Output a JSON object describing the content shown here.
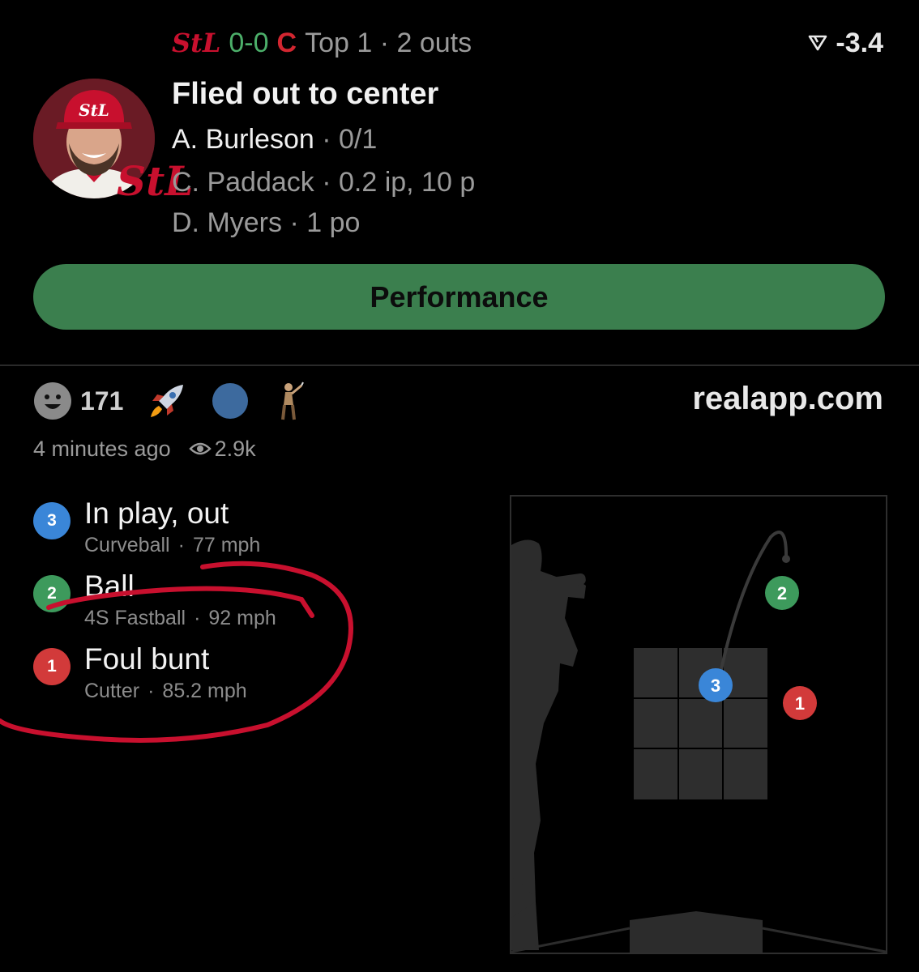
{
  "header": {
    "away_team_logo": "StL",
    "score": "0-0",
    "home_team_logo": "C",
    "inning_status": "Top 1 · 2 outs",
    "win_prob_change": "-3.4",
    "team_color_away": "#c8102e",
    "team_color_home": "#d22630"
  },
  "play": {
    "title": "Flied out to center",
    "batter_name": "A. Burleson",
    "batter_stats": "· 0/1",
    "pitcher_name": "C. Paddack",
    "pitcher_stats": "· 0.2 ip, 10 p",
    "fielder_name": "D. Myers",
    "fielder_stats": "· 1 po"
  },
  "performance_button": "Performance",
  "reactions": {
    "count": "171",
    "icons": [
      "smiley-icon",
      "rocket-icon",
      "blue-circle-icon",
      "golfer-icon"
    ]
  },
  "source": "realapp.com",
  "meta": {
    "time_ago": "4 minutes ago",
    "views": "2.9k"
  },
  "pitches": [
    {
      "number": "3",
      "result": "In play, out",
      "type": "Curveball",
      "speed": "77 mph",
      "color": "#3a86d8"
    },
    {
      "number": "2",
      "result": "Ball",
      "type": "4S Fastball",
      "speed": "92 mph",
      "color": "#3d9a5c"
    },
    {
      "number": "1",
      "result": "Foul bunt",
      "type": "Cutter",
      "speed": "85.2 mph",
      "color": "#d23a3a"
    }
  ],
  "accent_colors": {
    "performance_button": "#3b7f4e",
    "annotation_circle": "#c8102e"
  }
}
